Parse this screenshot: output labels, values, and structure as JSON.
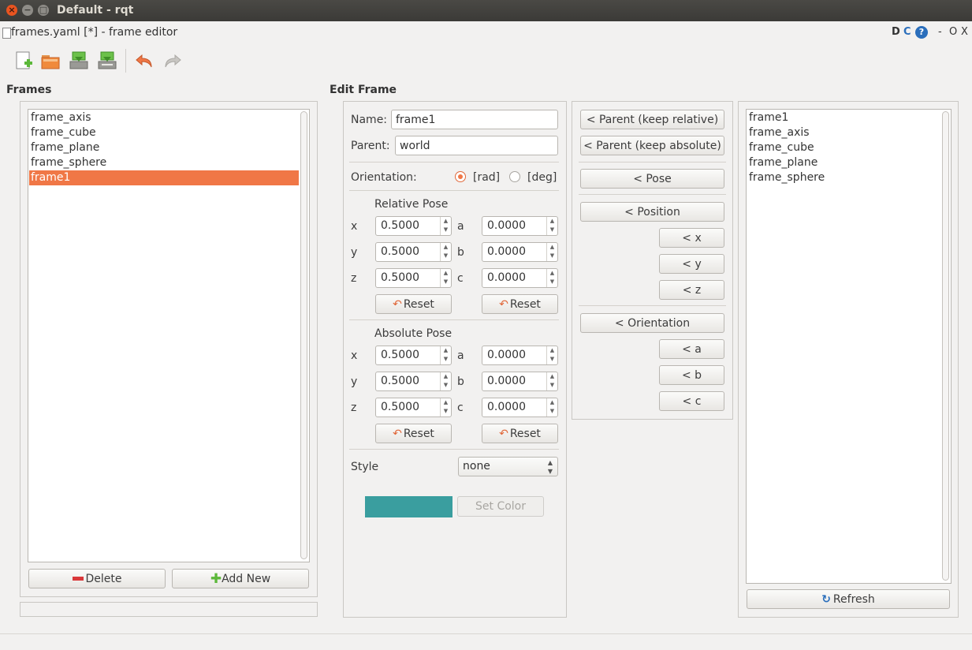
{
  "window": {
    "title": "Default - rqt"
  },
  "plugin": {
    "title": "frames.yaml [*] - frame editor",
    "controls": [
      "D",
      "C",
      "?",
      "-",
      "O",
      "X"
    ]
  },
  "toolbar": {
    "icons": [
      "new-file-icon",
      "open-folder-icon",
      "save-icon",
      "save-as-icon",
      "undo-icon",
      "redo-icon"
    ]
  },
  "frames_panel": {
    "title": "Frames",
    "items": [
      "frame_axis",
      "frame_cube",
      "frame_plane",
      "frame_sphere",
      "frame1"
    ],
    "selected": "frame1",
    "delete_label": "Delete",
    "add_label": "Add New"
  },
  "edit_frame": {
    "title": "Edit Frame",
    "name_label": "Name:",
    "name_value": "frame1",
    "parent_label": "Parent:",
    "parent_value": "world",
    "orientation_label": "Orientation:",
    "rad_label": "[rad]",
    "deg_label": "[deg]",
    "orientation_selected": "rad",
    "relative": {
      "title": "Relative Pose",
      "x_label": "x",
      "y_label": "y",
      "z_label": "z",
      "a_label": "a",
      "b_label": "b",
      "c_label": "c",
      "x": "0.5000",
      "y": "0.5000",
      "z": "0.5000",
      "a": "0.0000",
      "b": "0.0000",
      "c": "0.0000",
      "reset_label": "Reset"
    },
    "absolute": {
      "title": "Absolute Pose",
      "x_label": "x",
      "y_label": "y",
      "z_label": "z",
      "a_label": "a",
      "b_label": "b",
      "c_label": "c",
      "x": "0.5000",
      "y": "0.5000",
      "z": "0.5000",
      "a": "0.0000",
      "b": "0.0000",
      "c": "0.0000",
      "reset_label": "Reset"
    },
    "style_label": "Style",
    "style_value": "none",
    "color_swatch": "#3a9e9f",
    "set_color_label": "Set Color"
  },
  "copy_buttons": {
    "parent_relative": "< Parent (keep relative)",
    "parent_absolute": "< Parent (keep absolute)",
    "pose": "< Pose",
    "position": "< Position",
    "x": "< x",
    "y": "< y",
    "z": "< z",
    "orientation": "< Orientation",
    "a": "< a",
    "b": "< b",
    "c": "< c"
  },
  "tf_panel": {
    "items": [
      "frame1",
      "frame_axis",
      "frame_cube",
      "frame_plane",
      "frame_sphere"
    ],
    "refresh_label": "Refresh"
  },
  "colors": {
    "accent": "#f07746",
    "titlebar": "#3b3a37",
    "close": "#e95420"
  }
}
